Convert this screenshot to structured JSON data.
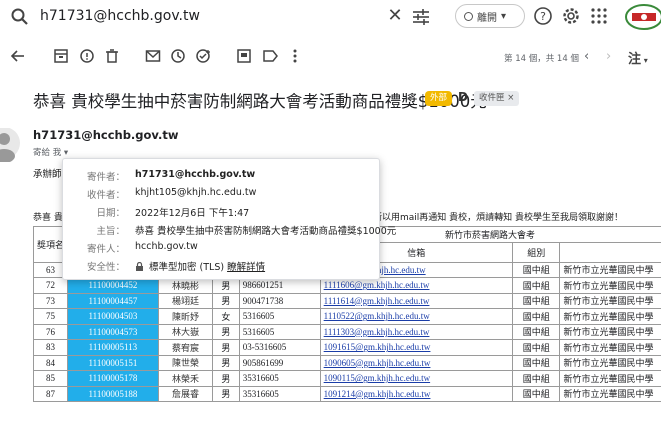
{
  "search": {
    "query": "h71731@hcchb.gov.tw"
  },
  "status": {
    "label": "離開"
  },
  "toolbar": {
    "page_count": "第 14 個，共 14 個",
    "lang": "注"
  },
  "email": {
    "subject": "恭喜 貴校學生抽中菸害防制網路大會考活動商品禮獎$1000元",
    "label_chip": "外部",
    "label_d": "D",
    "inbox_chip": "收件匣 ×",
    "sender": "h71731@hcchb.gov.tw",
    "to_me": "寄給 我 ▾",
    "body_frag1": "承辦師",
    "body_frag2": "恭喜 貴",
    "body_frag3": "所以用mail再通知 貴校，煩請轉知 貴校學生至我局領取謝謝！"
  },
  "details": {
    "from_key": "寄件者：",
    "from_val": "h71731@hcchb.gov.tw",
    "to_key": "收件者：",
    "to_val": "khjht105@khjh.hc.edu.tw",
    "date_key": "日期：",
    "date_val": "2022年12月6日 下午1:47",
    "subject_key": "主旨：",
    "subject_val": "恭喜 貴校學生抽中菸害防制網路大會考活動商品禮獎$1000元",
    "sentby_key": "寄件人：",
    "sentby_val": "hcchb.gov.tw",
    "security_key": "安全性：",
    "security_val": "標準型加密 (TLS)",
    "security_link": "瞭解詳情"
  },
  "table": {
    "title": "新竹市菸害網路大會考",
    "award_label": "獎項名",
    "col_email": "信箱",
    "col_group": "組別",
    "rows": [
      {
        "no": "63",
        "id": "11100003998",
        "name": "劉學璋",
        "sex": "男",
        "tel": "35316605",
        "email": "110010@gm.khjh.hc.edu.tw",
        "group": "國中組",
        "school": "新竹市立光華國民中學"
      },
      {
        "no": "72",
        "id": "11100004452",
        "name": "林曉彬",
        "sex": "男",
        "tel": "986601251",
        "email": "1111606@gm.khjh.hc.edu.tw",
        "group": "國中組",
        "school": "新竹市立光華國民中學"
      },
      {
        "no": "73",
        "id": "11100004457",
        "name": "楊翊廷",
        "sex": "男",
        "tel": "900471738",
        "email": "1111614@gm.khjh.hc.edu.tw",
        "group": "國中組",
        "school": "新竹市立光華國民中學"
      },
      {
        "no": "75",
        "id": "11100004503",
        "name": "陳昕妤",
        "sex": "女",
        "tel": "5316605",
        "email": "1110522@gm.khjh.hc.edu.tw",
        "group": "國中組",
        "school": "新竹市立光華國民中學"
      },
      {
        "no": "76",
        "id": "11100004573",
        "name": "林大嶽",
        "sex": "男",
        "tel": "5316605",
        "email": "1111303@gm.khjh.hc.edu.tw",
        "group": "國中組",
        "school": "新竹市立光華國民中學"
      },
      {
        "no": "83",
        "id": "11100005113",
        "name": "蔡宥宸",
        "sex": "男",
        "tel": "03-5316605",
        "email": "1091615@gm.khjh.hc.edu.tw",
        "group": "國中組",
        "school": "新竹市立光華國民中學"
      },
      {
        "no": "84",
        "id": "11100005151",
        "name": "陳世榮",
        "sex": "男",
        "tel": "905861699",
        "email": "1090605@gm.khjh.hc.edu.tw",
        "group": "國中組",
        "school": "新竹市立光華國民中學"
      },
      {
        "no": "85",
        "id": "11100005178",
        "name": "林榮禾",
        "sex": "男",
        "tel": "35316605",
        "email": "1090115@gm.khjh.hc.edu.tw",
        "group": "國中組",
        "school": "新竹市立光華國民中學"
      },
      {
        "no": "87",
        "id": "11100005188",
        "name": "詹展睿",
        "sex": "男",
        "tel": "35316605",
        "email": "1091214@gm.khjh.hc.edu.tw",
        "group": "國中組",
        "school": "新竹市立光華國民中學"
      }
    ]
  },
  "colors": {
    "accent": "#22aeea",
    "chip": "#f2b900",
    "link": "#1a3da8"
  }
}
